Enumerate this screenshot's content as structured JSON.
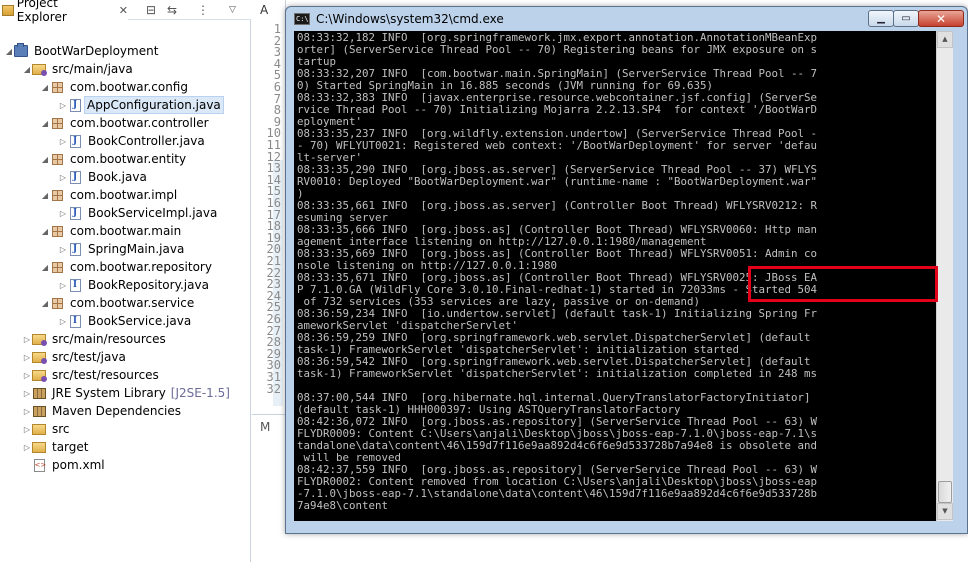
{
  "explorer": {
    "tab_label": "Project Explorer",
    "close_glyph": "✕",
    "toolbar_icons": [
      "collapse-all-icon",
      "link-with-editor-icon",
      "filters-icon",
      "view-menu-icon"
    ],
    "items": [
      {
        "label": "BootWarDeployment",
        "icon": "project-icon",
        "expanded": true
      },
      {
        "label": "src/main/java",
        "icon": "source-folder-icon",
        "expanded": true
      },
      {
        "label": "com.bootwar.config",
        "icon": "package-icon",
        "expanded": true
      },
      {
        "label": "AppConfiguration.java",
        "icon": "java-file-icon",
        "selected": true
      },
      {
        "label": "com.bootwar.controller",
        "icon": "package-icon",
        "expanded": true
      },
      {
        "label": "BookController.java",
        "icon": "java-file-icon"
      },
      {
        "label": "com.bootwar.entity",
        "icon": "package-icon",
        "expanded": true
      },
      {
        "label": "Book.java",
        "icon": "java-file-icon"
      },
      {
        "label": "com.bootwar.impl",
        "icon": "package-icon",
        "expanded": true
      },
      {
        "label": "BookServiceImpl.java",
        "icon": "java-file-icon"
      },
      {
        "label": "com.bootwar.main",
        "icon": "package-icon",
        "expanded": true
      },
      {
        "label": "SpringMain.java",
        "icon": "java-file-icon"
      },
      {
        "label": "com.bootwar.repository",
        "icon": "package-icon",
        "expanded": true
      },
      {
        "label": "BookRepository.java",
        "icon": "java-interface-icon"
      },
      {
        "label": "com.bootwar.service",
        "icon": "package-icon",
        "expanded": true
      },
      {
        "label": "BookService.java",
        "icon": "java-interface-icon"
      },
      {
        "label": "src/main/resources",
        "icon": "source-folder-icon"
      },
      {
        "label": "src/test/java",
        "icon": "source-folder-icon"
      },
      {
        "label": "src/test/resources",
        "icon": "source-folder-icon"
      },
      {
        "label": "JRE System Library",
        "suffix": "[J2SE-1.5]",
        "icon": "library-icon"
      },
      {
        "label": "Maven Dependencies",
        "icon": "library-icon"
      },
      {
        "label": "src",
        "icon": "folder-icon"
      },
      {
        "label": "target",
        "icon": "folder-icon"
      },
      {
        "label": "pom.xml",
        "icon": "xml-file-icon"
      }
    ]
  },
  "editor": {
    "tab_label": "A",
    "bottom_tab_label": "M",
    "line_numbers": [
      "1",
      "2",
      "3",
      "4",
      "5",
      "6",
      "7",
      "8",
      "9",
      "10",
      "11",
      "12",
      "13",
      "14",
      "15",
      "16",
      "17",
      "18",
      "19",
      "20",
      "21",
      "22",
      "23",
      "24",
      "25",
      "26",
      "27",
      "28",
      "29",
      "30",
      "31",
      "32"
    ]
  },
  "cmd": {
    "title": "C:\\Windows\\system32\\cmd.exe",
    "icon_text": "C:\\",
    "min_glyph": "▁",
    "max_glyph": "▭",
    "close_glyph": "✕",
    "lines": [
      "08:33:32,182 INFO  [org.springframework.jmx.export.annotation.AnnotationMBeanExp",
      "orter] (ServerService Thread Pool -- 70) Registering beans for JMX exposure on s",
      "tartup",
      "08:33:32,207 INFO  [com.bootwar.main.SpringMain] (ServerService Thread Pool -- 7",
      "0) Started SpringMain in 16.885 seconds (JVM running for 69.635)",
      "08:33:32,383 INFO  [javax.enterprise.resource.webcontainer.jsf.config] (ServerSe",
      "rvice Thread Pool -- 70) Initializing Mojarra 2.2.13.SP4  for context '/BootWarD",
      "eployment'",
      "08:33:35,237 INFO  [org.wildfly.extension.undertow] (ServerService Thread Pool -",
      "- 70) WFLYUT0021: Registered web context: '/BootWarDeployment' for server 'defau",
      "lt-server'",
      "08:33:35,290 INFO  [org.jboss.as.server] (ServerService Thread Pool -- 37) WFLYS",
      "RV0010: Deployed \"BootWarDeployment.war\" (runtime-name : \"BootWarDeployment.war\"",
      ")",
      "08:33:35,661 INFO  [org.jboss.as.server] (Controller Boot Thread) WFLYSRV0212: R",
      "esuming server",
      "08:33:35,666 INFO  [org.jboss.as] (Controller Boot Thread) WFLYSRV0060: Http man",
      "agement interface listening on http://127.0.0.1:1980/management",
      "08:33:35,669 INFO  [org.jboss.as] (Controller Boot Thread) WFLYSRV0051: Admin co",
      "nsole listening on http://127.0.0.1:1980",
      "08:33:35,671 INFO  [org.jboss.as] (Controller Boot Thread) WFLYSRV0025: JBoss EA",
      "P 7.1.0.GA (WildFly Core 3.0.10.Final-redhat-1) started in 72033ms - Started 504",
      " of 732 services (353 services are lazy, passive or on-demand)",
      "08:36:59,234 INFO  [io.undertow.servlet] (default task-1) Initializing Spring Fr",
      "ameworkServlet 'dispatcherServlet'",
      "08:36:59,259 INFO  [org.springframework.web.servlet.DispatcherServlet] (default",
      "task-1) FrameworkServlet 'dispatcherServlet': initialization started",
      "08:36:59,542 INFO  [org.springframework.web.servlet.DispatcherServlet] (default",
      "task-1) FrameworkServlet 'dispatcherServlet': initialization completed in 248 ms",
      "",
      "08:37:00,544 INFO  [org.hibernate.hql.internal.QueryTranslatorFactoryInitiator]",
      "(default task-1) HHH000397: Using ASTQueryTranslatorFactory",
      "08:42:36,072 INFO  [org.jboss.as.repository] (ServerService Thread Pool -- 63) W",
      "FLYDR0009: Content C:\\Users\\anjali\\Desktop\\jboss\\jboss-eap-7.1.0\\jboss-eap-7.1\\s",
      "tandalone\\data\\content\\46\\159d7f116e9aa892d4c6f6e9d533728b7a94e8 is obsolete and",
      " will be removed",
      "08:42:37,559 INFO  [org.jboss.as.repository] (ServerService Thread Pool -- 63) W",
      "FLYDR0002: Content removed from location C:\\Users\\anjali\\Desktop\\jboss\\jboss-eap",
      "-7.1.0\\jboss-eap-7.1\\standalone\\data\\content\\46\\159d7f116e9aa892d4c6f6e9d533728b",
      "7a94e8\\content"
    ],
    "scroll_up_glyph": "▲",
    "scroll_down_glyph": "▼"
  },
  "colors": {
    "console_bg": "#000000",
    "console_text": "#c0c0c0",
    "highlight": "#e3001b",
    "selection": "#dae8f8"
  }
}
